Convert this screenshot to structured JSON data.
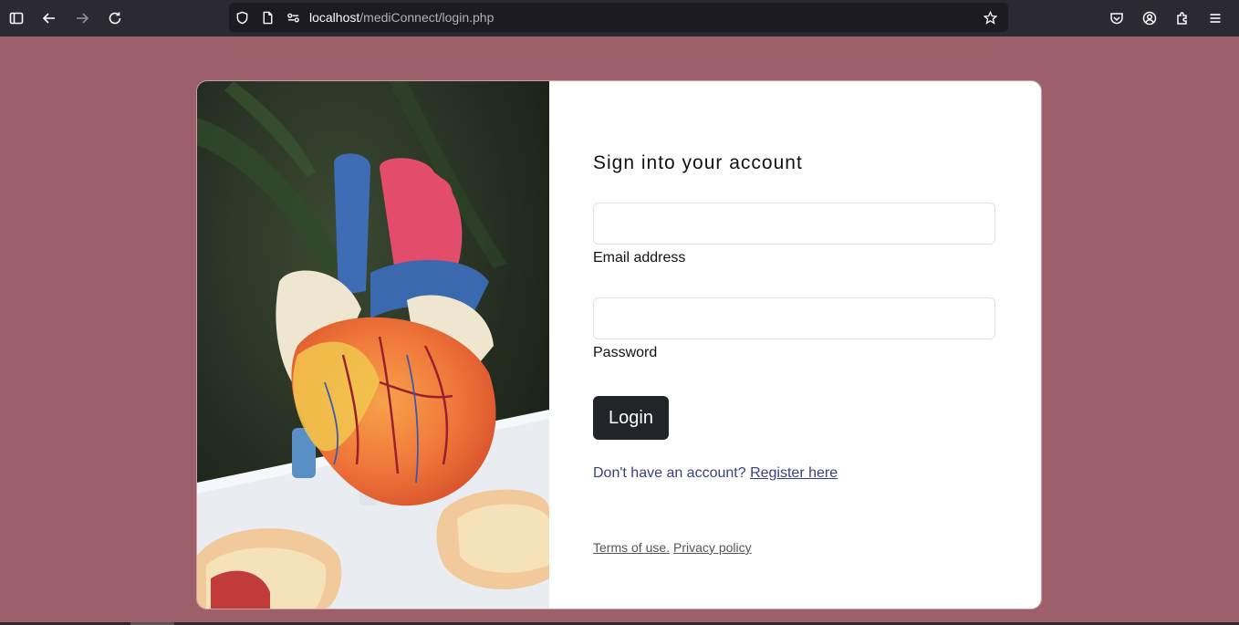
{
  "browser": {
    "url_host": "localhost",
    "url_path": "/mediConnect/login.php"
  },
  "login": {
    "title": "Sign into your account",
    "email_label": "Email address",
    "password_label": "Password",
    "email_value": "",
    "password_value": "",
    "login_button": "Login",
    "register_prompt": "Don't have an account?",
    "register_link": "Register here",
    "terms_link": "Terms of use.",
    "privacy_link": "Privacy policy"
  },
  "colors": {
    "page_background": "#9d606a",
    "button_background": "#212529",
    "link_color": "#393f81"
  }
}
